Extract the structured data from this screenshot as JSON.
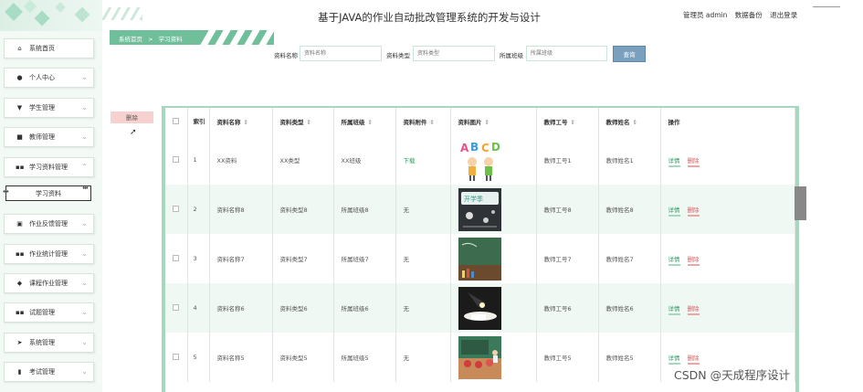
{
  "header": {
    "title": "基于JAVA的作业自动批改管理系统的开发与设计",
    "links": [
      "管理员 admin",
      "数据备份",
      "退出登录"
    ]
  },
  "breadcrumb": {
    "home": "系统首页",
    "separator": ">",
    "current": "学习资料"
  },
  "sidebar": {
    "items": [
      {
        "label": "系统首页",
        "icon": "home-icon",
        "glyph": "⌂",
        "has_chevron": false
      },
      {
        "label": "个人中心",
        "icon": "user-icon",
        "glyph": "●",
        "has_chevron": true
      },
      {
        "label": "学生管理",
        "icon": "student-icon",
        "glyph": "▼",
        "has_chevron": true
      },
      {
        "label": "教师管理",
        "icon": "teacher-icon",
        "glyph": "■",
        "has_chevron": true
      },
      {
        "label": "学习资料管理",
        "icon": "grid-icon",
        "glyph": "▪▪",
        "has_chevron": true
      },
      {
        "label": "作业反馈管理",
        "icon": "clipboard-icon",
        "glyph": "▣",
        "has_chevron": true
      },
      {
        "label": "作业统计管理",
        "icon": "grid-icon",
        "glyph": "▪▪",
        "has_chevron": true
      },
      {
        "label": "课程作业管理",
        "icon": "pin-icon",
        "glyph": "◆",
        "has_chevron": true
      },
      {
        "label": "试题管理",
        "icon": "grid-icon",
        "glyph": "▪▪",
        "has_chevron": true
      },
      {
        "label": "系统管理",
        "icon": "send-icon",
        "glyph": "➤",
        "has_chevron": true
      },
      {
        "label": "考试管理",
        "icon": "chart-icon",
        "glyph": "▮",
        "has_chevron": true
      }
    ],
    "subitem": "学习资料"
  },
  "search": {
    "fields": [
      {
        "label": "资料名称",
        "placeholder": "资料名称"
      },
      {
        "label": "资料类型",
        "placeholder": "资料类型"
      },
      {
        "label": "所属班级",
        "placeholder": "所属班级"
      }
    ],
    "button": "查询"
  },
  "delete_button": "删除",
  "table": {
    "headers": [
      "索引",
      "资料名称",
      "资料类型",
      "所属班级",
      "资料附件",
      "资料图片",
      "教师工号",
      "教师姓名",
      "操作"
    ],
    "rows": [
      {
        "index": "1",
        "name": "XX资料",
        "type": "XX类型",
        "class": "XX班级",
        "attachment": "下载",
        "image": "abcd-kids-image",
        "teacher_no": "教师工号1",
        "teacher_name": "教师姓名1"
      },
      {
        "index": "2",
        "name": "资料名称8",
        "type": "资料类型8",
        "class": "所属班级8",
        "attachment": "无",
        "image": "chalkboard-image",
        "teacher_no": "教师工号8",
        "teacher_name": "教师姓名8"
      },
      {
        "index": "3",
        "name": "资料名称7",
        "type": "资料类型7",
        "class": "所属班级7",
        "attachment": "无",
        "image": "green-board-image",
        "teacher_no": "教师工号7",
        "teacher_name": "教师姓名7"
      },
      {
        "index": "4",
        "name": "资料名称6",
        "type": "资料类型6",
        "class": "所属班级6",
        "attachment": "无",
        "image": "desk-lamp-image",
        "teacher_no": "教师工号6",
        "teacher_name": "教师姓名6"
      },
      {
        "index": "5",
        "name": "资料名称5",
        "type": "资料类型5",
        "class": "所属班级5",
        "attachment": "无",
        "image": "classroom-image",
        "teacher_no": "教师工号5",
        "teacher_name": "教师姓名5"
      }
    ],
    "actions": {
      "detail": "详情",
      "delete": "删除"
    }
  },
  "watermark": "CSDN @天成程序设计",
  "colors": {
    "accent": "#6fbf9a",
    "sidebar_bg": "#f3f9f5",
    "row_alt": "#f0f8f3",
    "delete": "#d65c5c",
    "search_button": "#7aa0be"
  }
}
